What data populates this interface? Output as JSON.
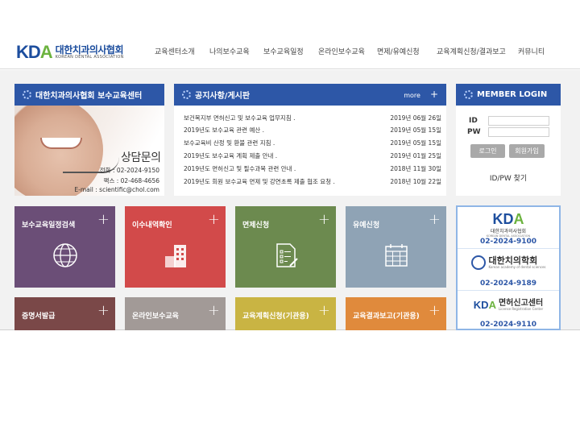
{
  "header": {
    "logo_mark": "KDA",
    "logo_ko": "대한치과의사협회",
    "logo_en": "KOREAN DENTAL ASSOCIATION",
    "nav": [
      "교육센터소개",
      "나의보수교육",
      "보수교육일정",
      "온라인보수교육",
      "면제/유예신청",
      "교육계획신청/결과보고",
      "커뮤니티"
    ]
  },
  "promo": {
    "header": "대한치과의사협회 보수교육센터",
    "title": "상담문의",
    "phone": "전화 : 02-2024-9150",
    "fax": "팩스 : 02-468-4656",
    "email": "E-mail : scientific@chol.com"
  },
  "notice": {
    "header": "공지사항/게시판",
    "more": "more",
    "items": [
      {
        "title": "보건복지부 면허신고 및 보수교육 업무지침 .",
        "date": "2019년 06월 26일"
      },
      {
        "title": "2019년도 보수교육 관련 예산 .",
        "date": "2019년 05월 15일"
      },
      {
        "title": "보수교육비 산정 및 환불 관련 지침 .",
        "date": "2019년 05월 15일"
      },
      {
        "title": "2019년도 보수교육 계획 제출 안내 .",
        "date": "2019년 01월 25일"
      },
      {
        "title": "2019년도 면허신고 및 필수과목 관련 안내 .",
        "date": "2018년 11월 30일"
      },
      {
        "title": "2019년도 회원 보수교육 면제 및 강연초록 제출 협조 요청 .",
        "date": "2018년 10월 22일"
      }
    ]
  },
  "login": {
    "header": "MEMBER LOGIN",
    "id_label": "ID",
    "pw_label": "PW",
    "id_value": "",
    "pw_value": "",
    "login_button": "로그인",
    "join_button": "회원가입",
    "find": "ID/PW 찾기"
  },
  "tiles": [
    {
      "label": "보수교육일정검색",
      "icon": "globe-icon",
      "color": "#6b4e77"
    },
    {
      "label": "이수내역확인",
      "icon": "building-icon",
      "color": "#d24a4a"
    },
    {
      "label": "면제신청",
      "icon": "document-edit-icon",
      "color": "#6c8a4f"
    },
    {
      "label": "유예신청",
      "icon": "calendar-icon",
      "color": "#8fa3b5"
    },
    {
      "label": "증명서발급",
      "icon": "certificate-icon",
      "color": "#7a4848"
    },
    {
      "label": "온라인보수교육",
      "icon": "monitor-icon",
      "color": "#a29a97"
    },
    {
      "label": "교육계획신청(기관용)",
      "icon": "plan-icon",
      "color": "#c9b443"
    },
    {
      "label": "교육결과보고(기관용)",
      "icon": "report-icon",
      "color": "#e08a3c"
    }
  ],
  "contacts": [
    {
      "logo": "KDA",
      "logo_sub": "대한치과의사협회",
      "logo_sub_en": "KOREAN DENTAL ASSOCIATION",
      "phone": "02-2024-9100"
    },
    {
      "logo": "대한치의학회",
      "logo_sub_en": "Korean academy of dental sciences",
      "phone": "02-2024-9189"
    },
    {
      "logo": "KDA",
      "logo_sub": "면허신고센터",
      "logo_sub_en": "License Registration Center",
      "phone": "02-2024-9110"
    }
  ],
  "colors": {
    "brand_blue": "#2d57a7",
    "brand_green": "#6cb33f"
  }
}
